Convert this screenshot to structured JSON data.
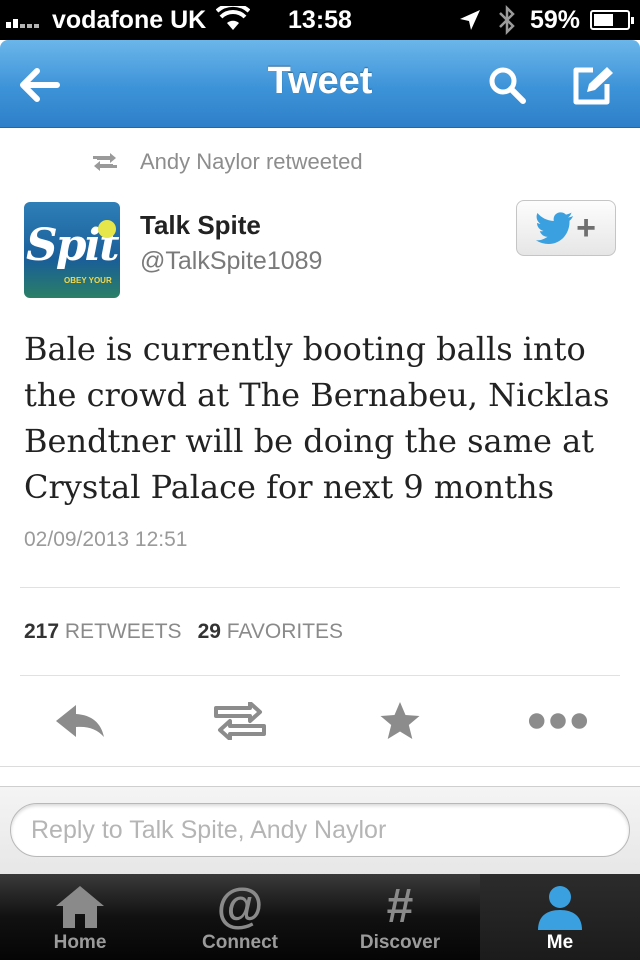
{
  "status_bar": {
    "carrier": "vodafone UK",
    "time": "13:58",
    "battery_percent": "59%",
    "battery_level": 0.59,
    "icons": [
      "signal-icon",
      "wifi-icon",
      "location-arrow-icon",
      "bluetooth-icon",
      "battery-icon"
    ]
  },
  "nav": {
    "title": "Tweet",
    "back_icon": "back-arrow-icon",
    "search_icon": "search-icon",
    "compose_icon": "compose-icon",
    "accent_color": "#3d93d8"
  },
  "tweet": {
    "retweeted_by": "Andy Naylor retweeted",
    "author_name": "Talk Spite",
    "author_handle": "@TalkSpite1089",
    "avatar_text": "Spit",
    "avatar_subtext": "OBEY YOUR",
    "text": "Bale is currently booting balls into the crowd at The Bernabeu, Nicklas Bendtner will be doing the same at Crystal Palace for next 9 months",
    "timestamp": "02/09/2013 12:51",
    "retweets_count": "217",
    "retweets_label": "RETWEETS",
    "favorites_count": "29",
    "favorites_label": "FAVORITES",
    "follow_button_label": "+"
  },
  "actions": [
    {
      "name": "reply-icon"
    },
    {
      "name": "retweet-icon"
    },
    {
      "name": "favorite-star-icon"
    },
    {
      "name": "more-dots-icon"
    }
  ],
  "reply": {
    "placeholder": "Reply to Talk Spite, Andy Naylor",
    "value": ""
  },
  "tabs": [
    {
      "label": "Home",
      "icon": "home-icon",
      "active": false
    },
    {
      "label": "Connect",
      "icon": "at-sign-icon",
      "active": false
    },
    {
      "label": "Discover",
      "icon": "hashtag-icon",
      "active": false
    },
    {
      "label": "Me",
      "icon": "person-icon",
      "active": true
    }
  ]
}
